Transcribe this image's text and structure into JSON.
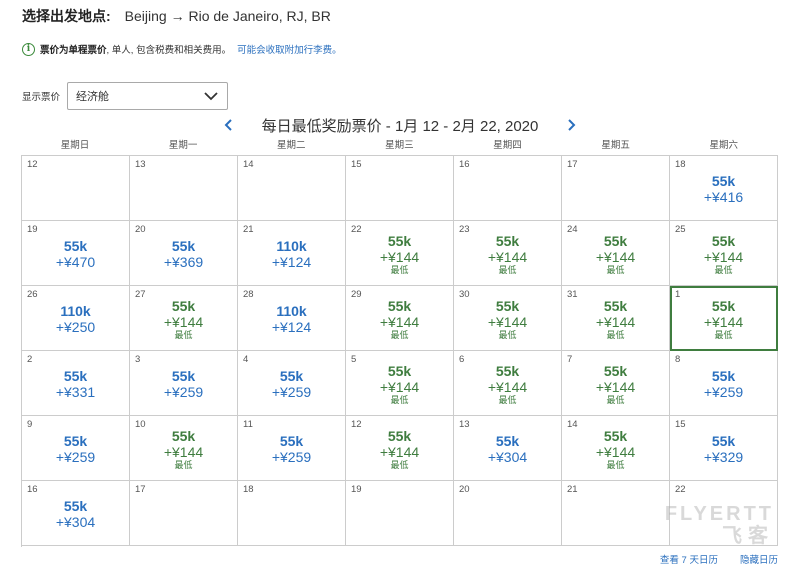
{
  "header": {
    "origin_label": "选择出发地点:",
    "route": "Beijing → Rio de Janeiro, RJ, BR"
  },
  "notice": {
    "icon": "info-icon",
    "bold_text": "票价为单程票价",
    "text": ", 单人, 包含税费和相关费用。",
    "link": "可能会收取附加行李费。"
  },
  "fare": {
    "label": "显示票价",
    "selected": "经济舱"
  },
  "calendar": {
    "title": "每日最低奖励票价 - 1月 12 - 2月 22, 2020",
    "weekdays": [
      "星期日",
      "星期一",
      "星期二",
      "星期三",
      "星期四",
      "星期五",
      "星期六"
    ],
    "weeks": [
      [
        {
          "day": "12"
        },
        {
          "day": "13"
        },
        {
          "day": "14"
        },
        {
          "day": "15"
        },
        {
          "day": "16"
        },
        {
          "day": "17"
        },
        {
          "day": "18",
          "miles": "55k",
          "tax": "+¥416"
        }
      ],
      [
        {
          "day": "19",
          "miles": "55k",
          "tax": "+¥470"
        },
        {
          "day": "20",
          "miles": "55k",
          "tax": "+¥369"
        },
        {
          "day": "21",
          "miles": "110k",
          "tax": "+¥124"
        },
        {
          "day": "22",
          "miles": "55k",
          "tax": "+¥144",
          "tag": "最低"
        },
        {
          "day": "23",
          "miles": "55k",
          "tax": "+¥144",
          "tag": "最低"
        },
        {
          "day": "24",
          "miles": "55k",
          "tax": "+¥144",
          "tag": "最低"
        },
        {
          "day": "25",
          "miles": "55k",
          "tax": "+¥144",
          "tag": "最低"
        }
      ],
      [
        {
          "day": "26",
          "miles": "110k",
          "tax": "+¥250"
        },
        {
          "day": "27",
          "miles": "55k",
          "tax": "+¥144",
          "tag": "最低"
        },
        {
          "day": "28",
          "miles": "110k",
          "tax": "+¥124"
        },
        {
          "day": "29",
          "miles": "55k",
          "tax": "+¥144",
          "tag": "最低"
        },
        {
          "day": "30",
          "miles": "55k",
          "tax": "+¥144",
          "tag": "最低"
        },
        {
          "day": "31",
          "miles": "55k",
          "tax": "+¥144",
          "tag": "最低"
        },
        {
          "day": "1",
          "miles": "55k",
          "tax": "+¥144",
          "tag": "最低",
          "selected": true
        }
      ],
      [
        {
          "day": "2",
          "miles": "55k",
          "tax": "+¥331"
        },
        {
          "day": "3",
          "miles": "55k",
          "tax": "+¥259"
        },
        {
          "day": "4",
          "miles": "55k",
          "tax": "+¥259"
        },
        {
          "day": "5",
          "miles": "55k",
          "tax": "+¥144",
          "tag": "最低"
        },
        {
          "day": "6",
          "miles": "55k",
          "tax": "+¥144",
          "tag": "最低"
        },
        {
          "day": "7",
          "miles": "55k",
          "tax": "+¥144",
          "tag": "最低"
        },
        {
          "day": "8",
          "miles": "55k",
          "tax": "+¥259"
        }
      ],
      [
        {
          "day": "9",
          "miles": "55k",
          "tax": "+¥259"
        },
        {
          "day": "10",
          "miles": "55k",
          "tax": "+¥144",
          "tag": "最低"
        },
        {
          "day": "11",
          "miles": "55k",
          "tax": "+¥259"
        },
        {
          "day": "12",
          "miles": "55k",
          "tax": "+¥144",
          "tag": "最低"
        },
        {
          "day": "13",
          "miles": "55k",
          "tax": "+¥304"
        },
        {
          "day": "14",
          "miles": "55k",
          "tax": "+¥144",
          "tag": "最低"
        },
        {
          "day": "15",
          "miles": "55k",
          "tax": "+¥329"
        }
      ],
      [
        {
          "day": "16",
          "miles": "55k",
          "tax": "+¥304"
        },
        {
          "day": "17"
        },
        {
          "day": "18"
        },
        {
          "day": "19"
        },
        {
          "day": "20"
        },
        {
          "day": "21"
        },
        {
          "day": "22"
        }
      ]
    ]
  },
  "footer": {
    "view_7_days": "查看 7 天日历",
    "hide_calendar": "隐藏日历"
  },
  "watermark": {
    "line1": "FLYERTT",
    "line2": "飞客"
  },
  "colors": {
    "link_blue": "#2a6fbe",
    "lowest_green": "#3f7d3f",
    "grid_border": "#cccccc"
  }
}
